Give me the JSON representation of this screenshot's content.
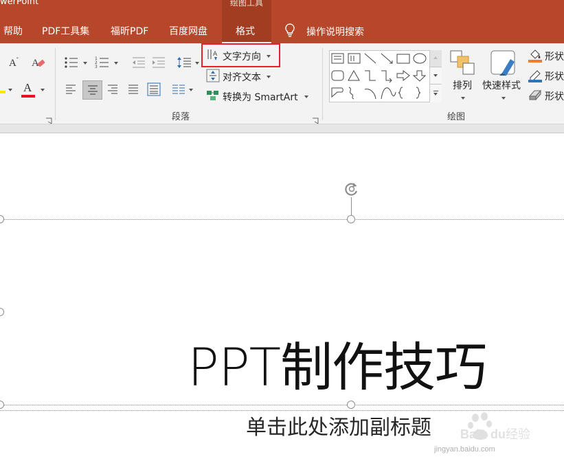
{
  "window": {
    "app_name": "werPoint",
    "context_group": "绘图工具"
  },
  "tabs": [
    {
      "label": "帮助"
    },
    {
      "label": "PDF工具集"
    },
    {
      "label": "福昕PDF"
    },
    {
      "label": "百度网盘"
    },
    {
      "label": "格式"
    }
  ],
  "tell_me": "操作说明搜索",
  "ribbon": {
    "paragraph": {
      "label": "段落",
      "text_direction": "文字方向",
      "align_text": "对齐文本",
      "convert_smartart": "转换为 SmartArt"
    },
    "drawing": {
      "label": "绘图",
      "arrange": "排列",
      "quick_styles": "快速样式",
      "shape_fill": "形状",
      "shape_outline": "形状",
      "shape_effects": "形状"
    }
  },
  "slide": {
    "title": "PPT制作技巧",
    "subtitle": "单击此处添加副标题"
  },
  "watermark": {
    "site": "jingyan.baidu.com"
  },
  "colors": {
    "accent": "#b7472a",
    "highlight": "#e8202e",
    "font_color": "#e81123"
  }
}
